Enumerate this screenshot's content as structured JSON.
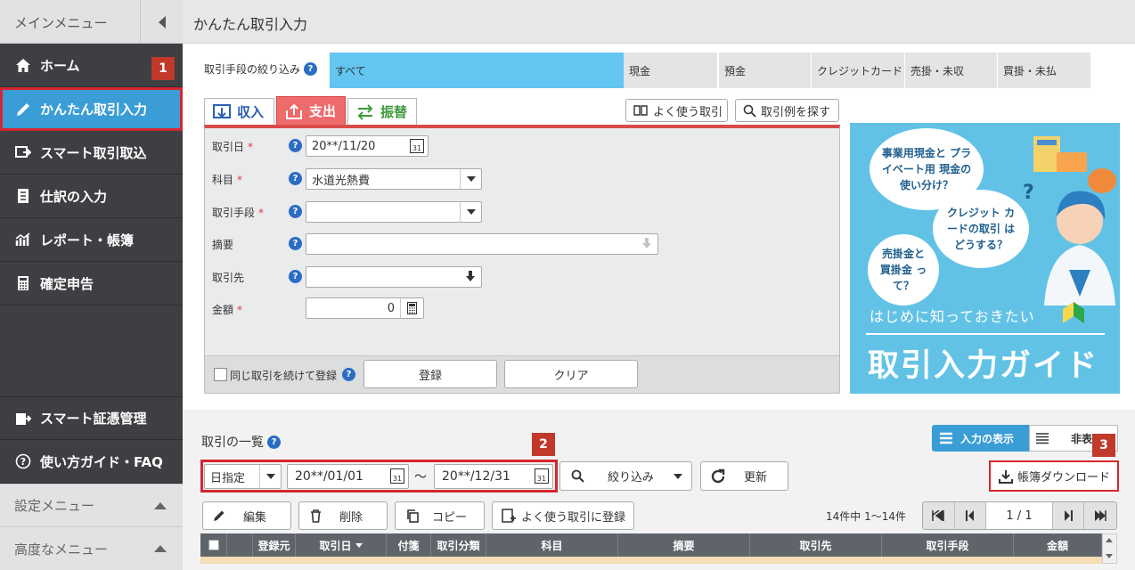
{
  "sidebar": {
    "header": "メインメニュー",
    "items": [
      {
        "label": "ホーム",
        "badge": "1"
      },
      {
        "label": "かんたん取引入力"
      },
      {
        "label": "スマート取引取込"
      },
      {
        "label": "仕訳の入力"
      },
      {
        "label": "レポート・帳簿"
      },
      {
        "label": "確定申告"
      },
      {
        "label": "スマート証憑管理"
      },
      {
        "label": "使い方ガイド・FAQ"
      }
    ],
    "settings": "設定メニュー",
    "advanced": "高度なメニュー"
  },
  "header": {
    "title": "かんたん取引入力"
  },
  "filter": {
    "label": "取引手段の絞り込み",
    "options": [
      "すべて",
      "現金",
      "預金",
      "クレジットカード",
      "売掛・未収",
      "買掛・未払"
    ]
  },
  "tabs": [
    "収入",
    "支出",
    "振替"
  ],
  "tools": {
    "frequent": "よく使う取引",
    "search_examples": "取引例を探す"
  },
  "form": {
    "date_label": "取引日",
    "date_value": "20**/11/20",
    "subject_label": "科目",
    "subject_value": "水道光熱費",
    "method_label": "取引手段",
    "memo_label": "摘要",
    "partner_label": "取引先",
    "amount_label": "金額",
    "amount_value": "0",
    "continue_label": "同じ取引を続けて登録",
    "register": "登録",
    "clear": "クリア",
    "req": "*",
    "cal_day": "31"
  },
  "banner": {
    "q1": "事業用現金と プライベート用 現金の 使い分け？",
    "q2": "クレジット カードの取引 はどうする？",
    "q3": "売掛金と 買掛金 って？",
    "sub": "はじめに知っておきたい",
    "title": "取引入力ガイド"
  },
  "list": {
    "title": "取引の一覧",
    "view_input": "入力の表示",
    "view_hide": "非表",
    "badge2": "2",
    "badge3": "3",
    "period_type": "日指定",
    "from": "20**/01/01",
    "sep": "〜",
    "to": "20**/12/31",
    "narrow": "絞り込み",
    "refresh": "更新",
    "download": "帳簿ダウンロード",
    "edit": "編集",
    "delete": "削除",
    "copy": "コピー",
    "register_frequent": "よく使う取引に登録",
    "count": "14件中 1〜14件",
    "page": "1 / 1",
    "columns": [
      "登録元",
      "取引日",
      "付箋",
      "取引分類",
      "科目",
      "摘要",
      "取引先",
      "取引手段",
      "金額"
    ]
  },
  "colors": {
    "accent": "#3a9dd6",
    "expense": "#ee6b6b",
    "sidebar": "#3d3f42"
  }
}
